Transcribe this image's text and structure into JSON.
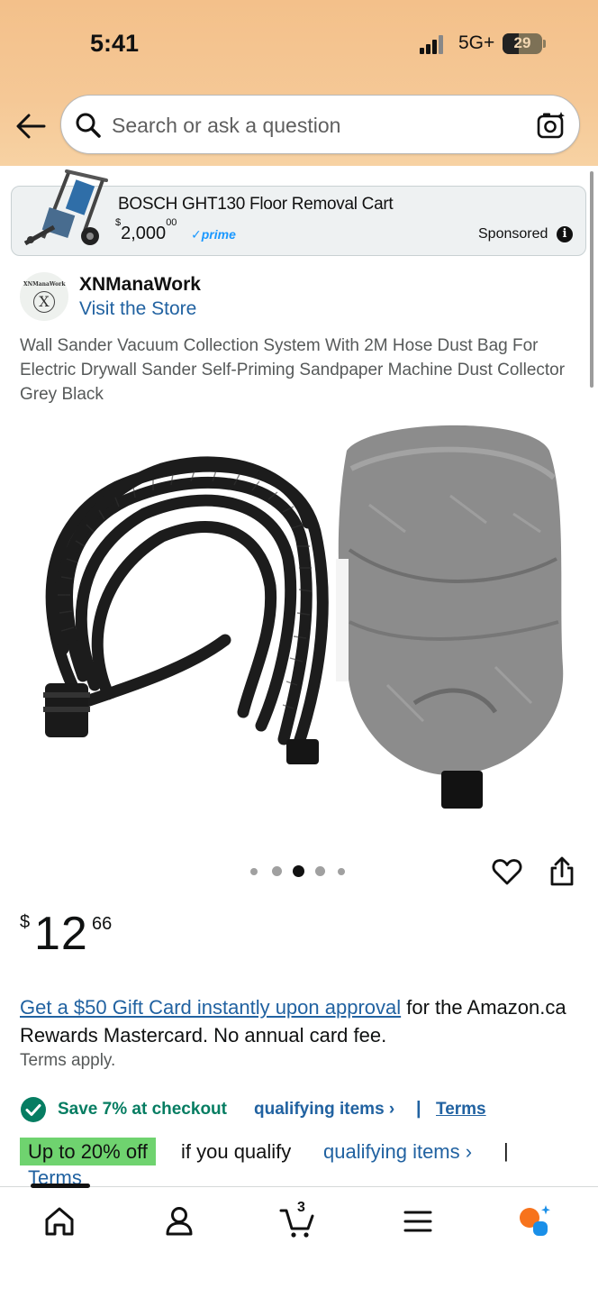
{
  "status_bar": {
    "time": "5:41",
    "network": "5G+",
    "battery": "29"
  },
  "search": {
    "placeholder": "Search or ask a question"
  },
  "sponsored": {
    "title": "BOSCH GHT130 Floor Removal Cart",
    "price_symbol": "$",
    "price_whole": "2,000",
    "price_fraction": "00",
    "prime": "✓prime",
    "label": "Sponsored"
  },
  "store": {
    "logo_text": "XNManaWork",
    "logo_letter": "X",
    "name": "XNManaWork",
    "visit_label": "Visit the Store"
  },
  "product": {
    "title": "Wall Sander Vacuum Collection System With 2M Hose Dust Bag For Electric Drywall Sander Self-Priming Sandpaper Machine Dust Collector Grey Black",
    "image_count": 5,
    "active_image_index": 2
  },
  "price": {
    "symbol": "$",
    "whole": "12",
    "fraction": "66"
  },
  "offer": {
    "link": "Get a $50 Gift Card instantly upon approval",
    "text": " for the Amazon.ca Rewards Mastercard. No annual card fee.",
    "terms": "Terms apply."
  },
  "save": {
    "text": "Save 7% at checkout",
    "link": "qualifying items ›",
    "separator": "|",
    "terms": "Terms"
  },
  "upto": {
    "badge": "Up to 20% off",
    "text": "if you qualify",
    "link": "qualifying items ›",
    "separator": "|",
    "terms": "Terms"
  },
  "cart": {
    "count": "3"
  },
  "colors": {
    "accent": "#2162a1",
    "header": "#f3c08a",
    "save_green": "#067d62",
    "badge_green": "#6fd36f"
  },
  "icons": {
    "nav": [
      "home-icon",
      "account-icon",
      "cart-icon",
      "menu-icon",
      "rufus-icon"
    ]
  }
}
